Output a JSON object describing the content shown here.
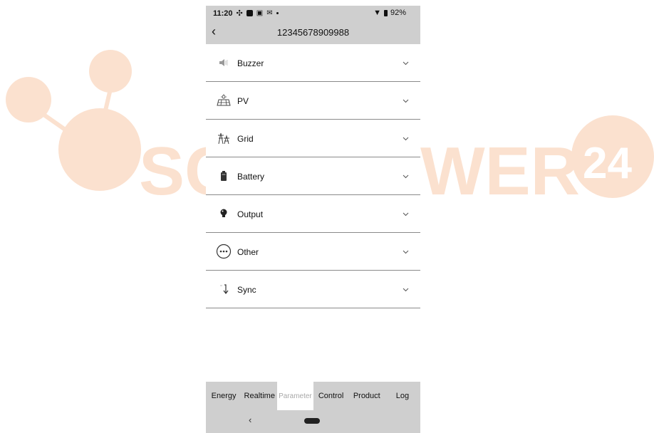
{
  "status": {
    "time": "11:20",
    "battery": "92%"
  },
  "header": {
    "title": "12345678909988"
  },
  "rows": [
    {
      "label": "Buzzer",
      "icon": "speaker-icon"
    },
    {
      "label": "PV",
      "icon": "solar-panel-icon"
    },
    {
      "label": "Grid",
      "icon": "grid-tower-icon"
    },
    {
      "label": "Battery",
      "icon": "battery-icon"
    },
    {
      "label": "Output",
      "icon": "bulb-icon"
    },
    {
      "label": "Other",
      "icon": "more-icon"
    },
    {
      "label": "Sync",
      "icon": "sync-icon"
    }
  ],
  "tabs": [
    {
      "label": "Energy"
    },
    {
      "label": "Realtime"
    },
    {
      "label": "Parameter",
      "active": true
    },
    {
      "label": "Control"
    },
    {
      "label": "Product"
    },
    {
      "label": "Log"
    }
  ],
  "colors": {
    "watermark": "#fbe1cf",
    "bars": "#cfcfcf",
    "divider": "#8a8a8a"
  }
}
